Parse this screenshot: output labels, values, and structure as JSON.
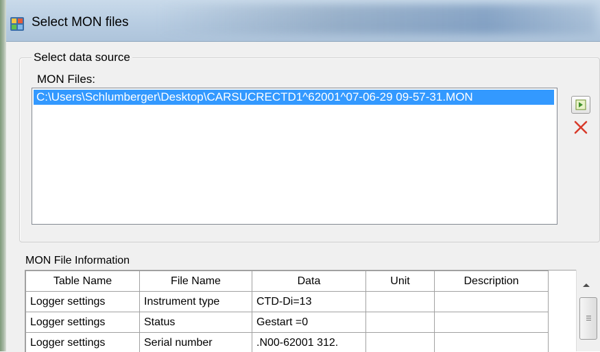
{
  "window": {
    "title": "Select MON files",
    "icon": "app-grid-icon"
  },
  "data_source": {
    "group_title": "Select data source",
    "list_label": "MON Files:",
    "files": [
      {
        "path": "C:\\Users\\Schlumberger\\Desktop\\CARSUCRECTD1^62001^07-06-29 09-57-31.MON",
        "selected": true
      }
    ],
    "add_button_icon": "add-file-icon",
    "remove_button_icon": "red-x-icon"
  },
  "info": {
    "title": "MON File Information",
    "columns": [
      "Table Name",
      "File Name",
      "Data",
      "Unit",
      "Description"
    ],
    "rows": [
      [
        "Logger settings",
        "Instrument type",
        "CTD-Di=13",
        "",
        ""
      ],
      [
        "Logger settings",
        "Status",
        "Gestart =0",
        "",
        ""
      ],
      [
        "Logger settings",
        "Serial number",
        ".N00-62001  312.",
        "",
        ""
      ]
    ]
  },
  "colors": {
    "selection": "#3399ff",
    "remove": "#d83a2a"
  }
}
